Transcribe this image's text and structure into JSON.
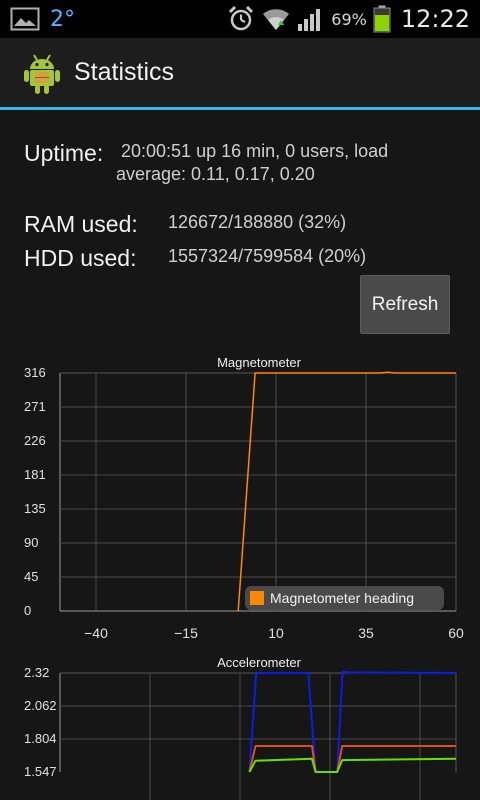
{
  "status_bar": {
    "weather_temp": "2°",
    "battery_percent": "69%",
    "time": "12:22"
  },
  "action_bar": {
    "title": "Statistics"
  },
  "stats": {
    "uptime_label": "Uptime:",
    "uptime_line1": "20:00:51 up 16 min,  0 users,  load",
    "uptime_line2": "average: 0.11, 0.17, 0.20",
    "ram_label": "RAM used:",
    "ram_value": "126672/188880 (32%)",
    "hdd_label": "HDD used:",
    "hdd_value": "1557324/7599584 (20%)",
    "refresh_label": "Refresh"
  },
  "chart_data": [
    {
      "type": "line",
      "title": "Magnetometer",
      "x_ticks": [
        "−40",
        "−15",
        "10",
        "35",
        "60"
      ],
      "y_ticks": [
        "316",
        "271",
        "226",
        "181",
        "135",
        "90",
        "45",
        "0"
      ],
      "xlim": [
        -50,
        60
      ],
      "ylim": [
        0,
        316
      ],
      "grid": true,
      "legend_position": "bottom-right",
      "series": [
        {
          "name": "Magnetometer heading",
          "color": "#ff8800",
          "points": [
            [
              -0.5,
              0
            ],
            [
              4.2,
              316
            ],
            [
              39,
              316
            ],
            [
              41,
              317
            ],
            [
              43,
              316
            ],
            [
              60,
              316
            ]
          ]
        }
      ]
    },
    {
      "type": "line",
      "title": "Accelerometer",
      "y_ticks": [
        "2.32",
        "2.062",
        "1.804",
        "1.547"
      ],
      "xlim": [
        -50,
        60
      ],
      "ylim": [
        1.547,
        2.32
      ],
      "grid": true,
      "series": [
        {
          "color": "#0a1ee6",
          "points": [
            [
              2.6,
              1.547
            ],
            [
              4.5,
              2.32
            ],
            [
              19,
              2.32
            ],
            [
              21,
              1.547
            ],
            [
              27,
              1.547
            ],
            [
              28.5,
              2.33
            ],
            [
              30,
              2.325
            ],
            [
              60,
              2.32
            ]
          ]
        },
        {
          "color": "#e04e10",
          "points": [
            [
              2.6,
              1.547
            ],
            [
              4.3,
              1.75
            ],
            [
              20,
              1.75
            ],
            [
              21,
              1.547
            ],
            [
              27,
              1.547
            ],
            [
              28.4,
              1.75
            ],
            [
              60,
              1.75
            ]
          ]
        },
        {
          "color": "#66e000",
          "points": [
            [
              2.6,
              1.547
            ],
            [
              4.3,
              1.635
            ],
            [
              20,
              1.65
            ],
            [
              21,
              1.547
            ],
            [
              27,
              1.547
            ],
            [
              28.4,
              1.64
            ],
            [
              60,
              1.65
            ]
          ]
        }
      ]
    }
  ]
}
